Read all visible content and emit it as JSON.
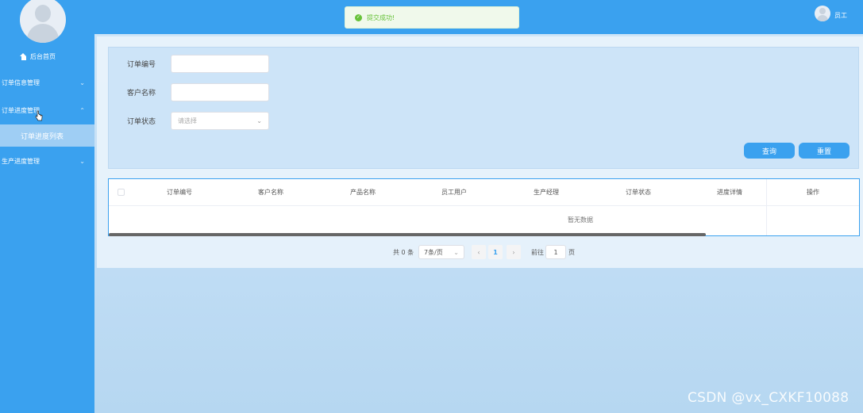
{
  "sidebar": {
    "home_label": "后台首页",
    "menus": [
      {
        "label": "订单信息管理",
        "expanded": false
      },
      {
        "label": "订单进度管理",
        "expanded": true
      },
      {
        "label": "生产进度管理",
        "expanded": false
      }
    ],
    "submenu_label": "订单进度列表"
  },
  "header": {
    "toast_message": "提交成功!",
    "user_name": "员工"
  },
  "search": {
    "order_no_label": "订单编号",
    "order_no_value": "",
    "customer_label": "客户名称",
    "customer_value": "",
    "status_label": "订单状态",
    "status_placeholder": "请选择",
    "query_button": "查询",
    "reset_button": "重置"
  },
  "table": {
    "columns": [
      "订单编号",
      "客户名称",
      "产品名称",
      "员工用户",
      "生产经理",
      "订单状态",
      "进度详情",
      "操作"
    ],
    "rows": [],
    "empty_text": "暂无数据"
  },
  "pagination": {
    "total_text": "共 0 条",
    "page_size": "7条/页",
    "current_page": "1",
    "goto_label": "前往",
    "goto_value": "1",
    "page_unit": "页"
  },
  "watermark": "CSDN @vx_CXKF10088",
  "colors": {
    "primary": "#3aa1ef",
    "success": "#67c23a",
    "submenu_active": "#9fcef4"
  },
  "icons": [
    "home-icon",
    "chevron-down-icon",
    "chevron-up-icon",
    "success-icon",
    "arrow-left-icon",
    "arrow-right-icon",
    "pointer-cursor-icon"
  ]
}
